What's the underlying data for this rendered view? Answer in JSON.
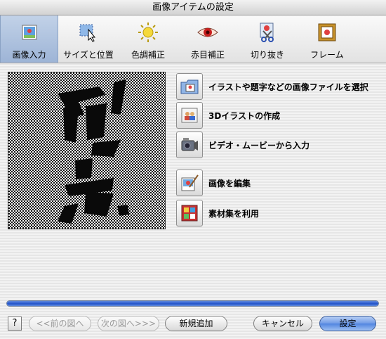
{
  "window": {
    "title": "画像アイテムの設定"
  },
  "toolbar": {
    "tabs": [
      {
        "label": "画像入力",
        "icon": "image-input-icon",
        "selected": true
      },
      {
        "label": "サイズと位置",
        "icon": "size-position-icon",
        "selected": false
      },
      {
        "label": "色調補正",
        "icon": "color-correction-icon",
        "selected": false
      },
      {
        "label": "赤目補正",
        "icon": "red-eye-icon",
        "selected": false
      },
      {
        "label": "切り抜き",
        "icon": "crop-icon",
        "selected": false
      },
      {
        "label": "フレーム",
        "icon": "frame-icon",
        "selected": false
      }
    ]
  },
  "actions": [
    {
      "label": "イラストや題字などの画像ファイルを選択",
      "icon": "folder-image-icon"
    },
    {
      "label": "3Dイラストの作成",
      "icon": "3d-illustration-icon"
    },
    {
      "label": "ビデオ・ムービーから入力",
      "icon": "video-camera-icon"
    },
    {
      "label": "画像を編集",
      "icon": "edit-image-icon"
    },
    {
      "label": "素材集を利用",
      "icon": "material-collection-icon"
    }
  ],
  "progress": {
    "value": 1.0
  },
  "footer": {
    "help_label": "?",
    "prev_label": "<<前の図へ",
    "next_label": "次の図へ>>>",
    "new_label": "新規追加",
    "cancel_label": "キャンセル",
    "ok_label": "設定"
  },
  "colors": {
    "accent": "#2a5bd2",
    "selected_tab": "#aabfe0",
    "dialog_bg": "#ececec"
  }
}
